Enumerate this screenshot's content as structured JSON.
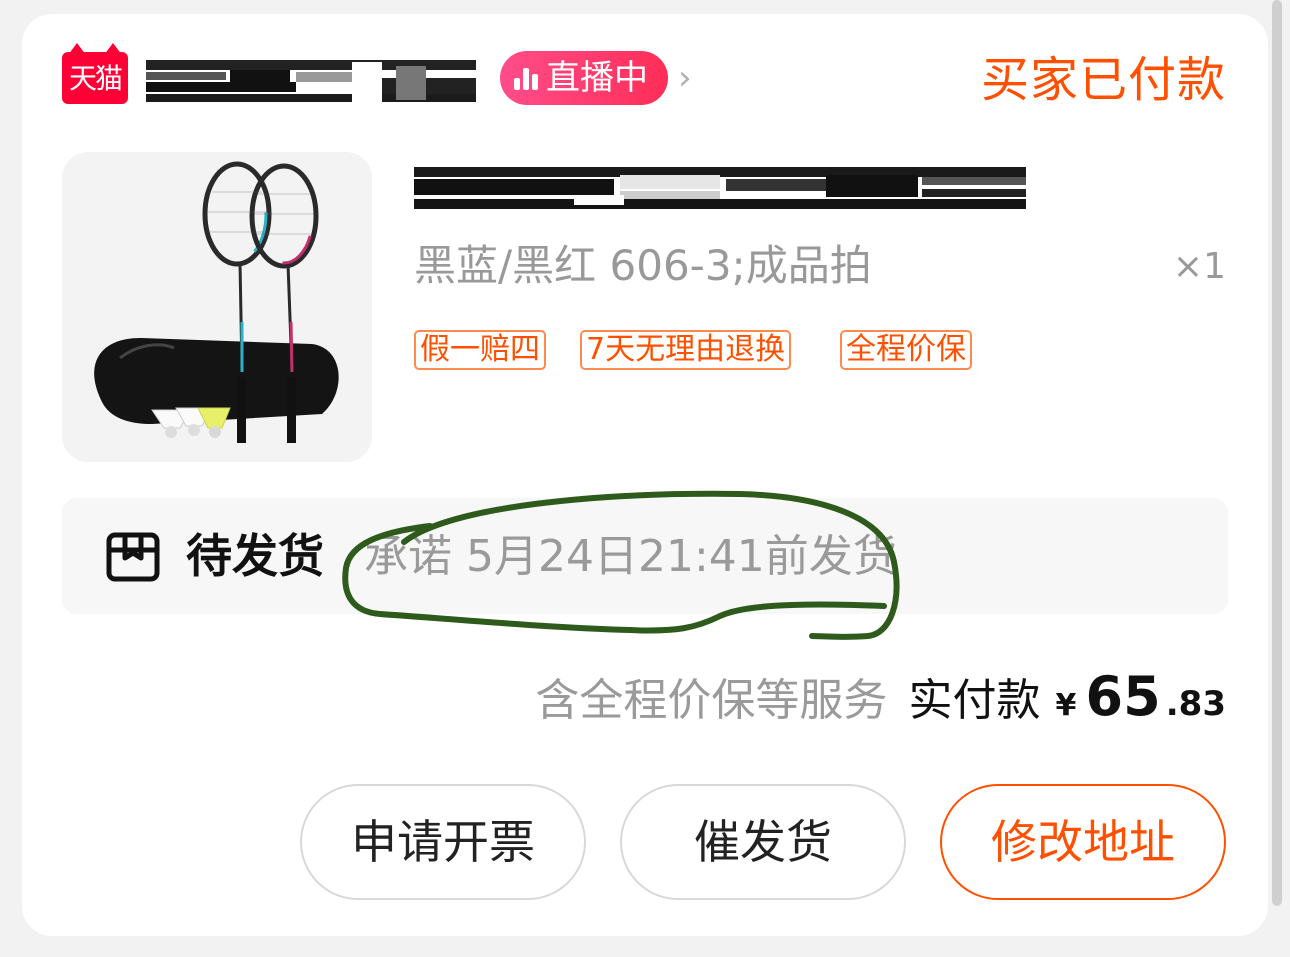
{
  "header": {
    "platform_badge": "天猫",
    "live_badge": "直播中",
    "order_status": "买家已付款"
  },
  "product": {
    "sku": "黑蓝/黑红 606-3;成品拍",
    "quantity": "×1",
    "tags": [
      "假一赔四",
      "7天无理由退换",
      "全程价保"
    ]
  },
  "shipping": {
    "status": "待发货",
    "promise": "承诺 5月24日21:41前发货"
  },
  "total": {
    "service_note": "含全程价保等服务",
    "label": "实付款",
    "currency": "¥",
    "amount_int": "65",
    "amount_dec": ".83"
  },
  "actions": {
    "invoice": "申请开票",
    "urge": "催发货",
    "edit_address": "修改地址"
  },
  "colors": {
    "accent": "#ff5000",
    "tmall_red": "#ff0036",
    "live_pink": "#ff2d57",
    "annotation_green": "#2e5a1c"
  }
}
